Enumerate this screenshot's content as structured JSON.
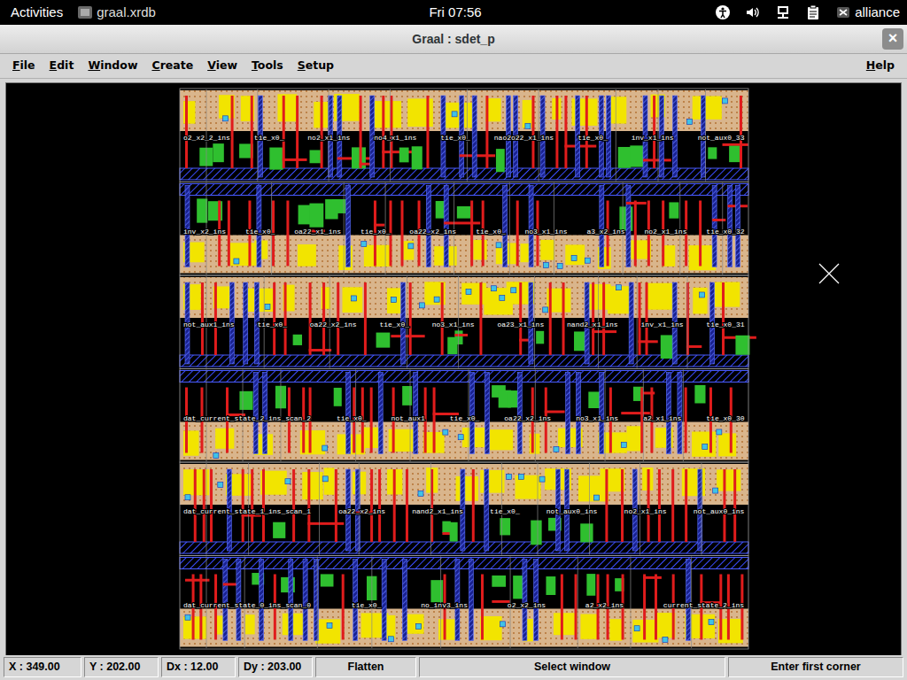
{
  "topbar": {
    "activities": "Activities",
    "app": "graal.xrdb",
    "clock": "Fri 07:56",
    "user": "alliance"
  },
  "window": {
    "title": "Graal : sdet_p",
    "close": "×"
  },
  "menu": {
    "items": [
      "File",
      "Edit",
      "Window",
      "Create",
      "View",
      "Tools",
      "Setup"
    ],
    "help": "Help"
  },
  "layout": {
    "rows": [
      {
        "labels": [
          "o2_x2_2_ins",
          "tie_x0_",
          "no2_x1_ins",
          "no4_x1_ins",
          "tie_x0_",
          "nao2o22_x1_ins",
          "tie_x0_",
          "inv_x1_ins",
          "not_aux0_33"
        ]
      },
      {
        "labels": [
          "inv_x2_ins",
          "tie_x0_",
          "oa22_x1_ins",
          "tie_x0_",
          "oa22_x2_ins",
          "tie_x0_",
          "no3_x1_ins",
          "a3_x2_ins",
          "no2_x1_ins",
          "tie_x0_32"
        ]
      },
      {
        "labels": [
          "not_aux1_ins",
          "tie_x0_",
          "oa22_x2_ins",
          "tie_x0_",
          "no3_x1_ins",
          "oa23_x1_ins",
          "nand2_x1_ins",
          "inv_x1_ins",
          "tie_x0_31"
        ]
      },
      {
        "labels": [
          "dat_current_state_2_ins_scan_2",
          "tie_x0_",
          "not_aux1",
          "tie_x0_",
          "oa22_x2_ins",
          "no3_x1_ins",
          "a2_x1_ins",
          "tie_x0_30"
        ]
      },
      {
        "labels": [
          "dat_current_state_1_ins_scan_1",
          "oa22_x2_ins",
          "nand2_x1_ins",
          "tie_x0_",
          "not_aux0_ins",
          "no2_x1_ins",
          "not_aux0_ins"
        ]
      },
      {
        "labels": [
          "dat_current_state_0_ins_scan_0",
          "tie_x0_",
          "no_inv3_ins",
          "o2_x2_ins",
          "a2_x2_ins",
          "current_state_2_ins"
        ]
      }
    ]
  },
  "status_bar": {
    "fields": [
      "X : 349.00",
      "Y : 202.00",
      "Dx : 12.00",
      "Dy : 203.00",
      "Flatten",
      "Select window",
      "Enter first corner"
    ]
  }
}
